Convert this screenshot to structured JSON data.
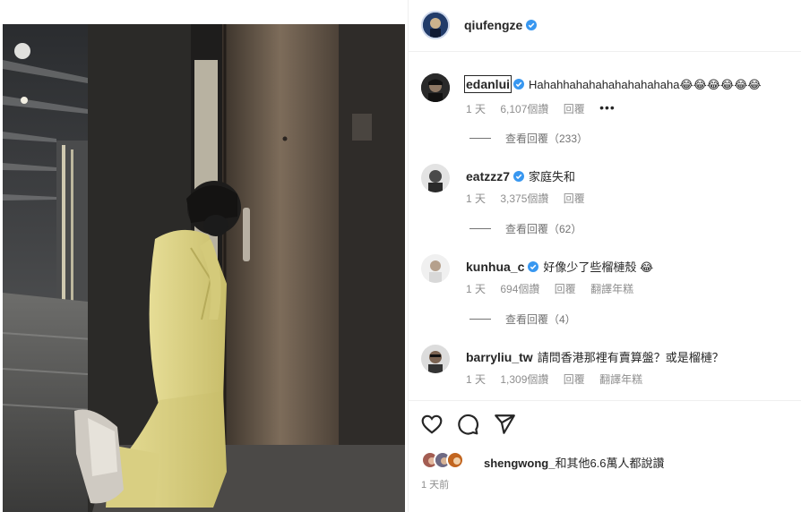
{
  "post": {
    "author": "qiufengze",
    "author_verified": true,
    "photo_description": "person in yellow suit kneeling before a door in a dim hotel corridor",
    "likes": {
      "first_liker": "shengwong_",
      "rest_text": "和其他6.6萬人都說讚"
    },
    "time_ago": "1 天前"
  },
  "comments": [
    {
      "username": "edanlui",
      "verified": true,
      "text": "Hahahhahahahahahahahaha😂😂😂😂😂😂",
      "time": "1 天",
      "likes": "6,107個讚",
      "reply": "回覆",
      "translate": "",
      "more": "•••",
      "view_replies": "查看回覆（233）"
    },
    {
      "username": "eatzzz7",
      "verified": true,
      "text": "家庭失和",
      "time": "1 天",
      "likes": "3,375個讚",
      "reply": "回覆",
      "translate": "",
      "more": "",
      "view_replies": "查看回覆（62）"
    },
    {
      "username": "kunhua_c",
      "verified": true,
      "text": "好像少了些榴槤殼 😂",
      "time": "1 天",
      "likes": "694個讚",
      "reply": "回覆",
      "translate": "翻譯年糕",
      "more": "",
      "view_replies": "查看回覆（4）"
    },
    {
      "username": "barryliu_tw",
      "verified": false,
      "text": "請問香港那裡有賣算盤？或是榴槤？",
      "time": "1 天",
      "likes": "1,309個讚",
      "reply": "回覆",
      "translate": "翻譯年糕",
      "more": "",
      "view_replies": ""
    }
  ],
  "actions": {
    "like": "heart-icon",
    "comment": "comment-icon",
    "share": "send-icon"
  },
  "colors": {
    "verified_blue": "#3897f0",
    "suit_yellow": "#d8cf7e",
    "meta_gray": "#8e8e8e"
  }
}
